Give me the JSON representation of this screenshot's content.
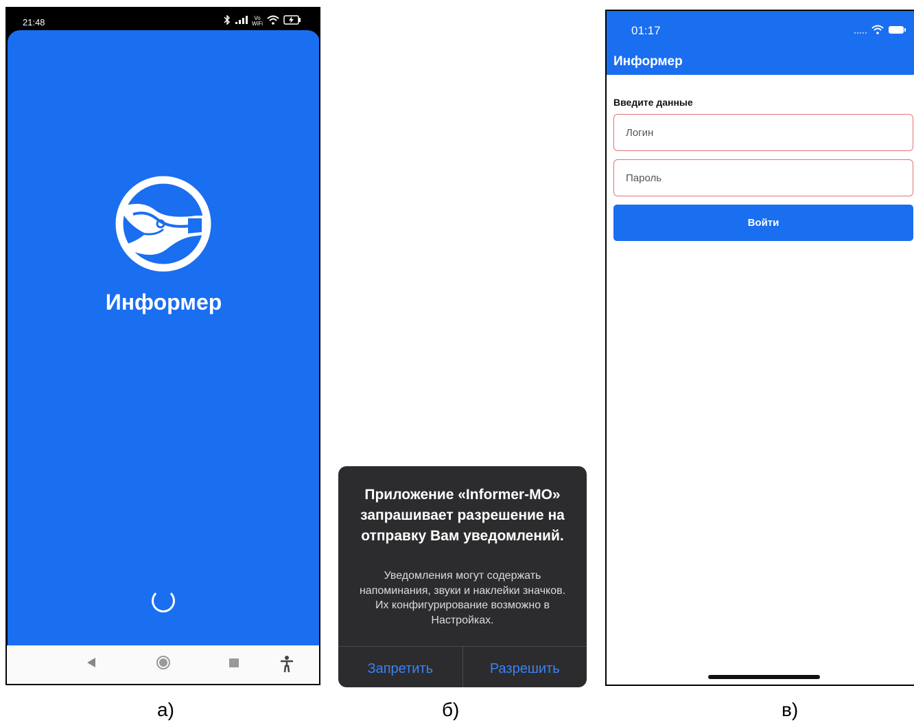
{
  "panel_a": {
    "status_time": "21:48",
    "status_icons": [
      "bluetooth-icon",
      "cell-signal-icon",
      "vowifi-icon",
      "wifi-icon",
      "battery-charging-icon"
    ],
    "vowifi_text": "Vo WiFi",
    "app_title": "Информер",
    "logo": "informer-logo",
    "nav_buttons": [
      "back-icon",
      "home-icon",
      "recents-icon",
      "accessibility-icon"
    ],
    "colors": {
      "background": "#1a6ef0",
      "text": "#ffffff"
    }
  },
  "panel_b": {
    "title": "Приложение «Informer-MO» запрашивает разрешение на отправку Вам уведомлений.",
    "message": "Уведомления могут содержать напоминания, звуки и наклейки значков. Их конфигурирование возможно в Настройках.",
    "deny_label": "Запретить",
    "allow_label": "Разрешить",
    "colors": {
      "background": "#2c2c2e",
      "button_text": "#3b82f6"
    }
  },
  "panel_c": {
    "status_time": "01:17",
    "status_icons": [
      "cell-signal-icon",
      "wifi-icon",
      "battery-icon"
    ],
    "header_title": "Информер",
    "form_label": "Введите данные",
    "login_placeholder": "Логин",
    "password_placeholder": "Пароль",
    "submit_label": "Войти",
    "colors": {
      "header": "#1a6ef0",
      "field_border": "#e57373",
      "button": "#1a6ef0"
    }
  },
  "captions": {
    "a": "а)",
    "b": "б)",
    "c": "в)"
  }
}
